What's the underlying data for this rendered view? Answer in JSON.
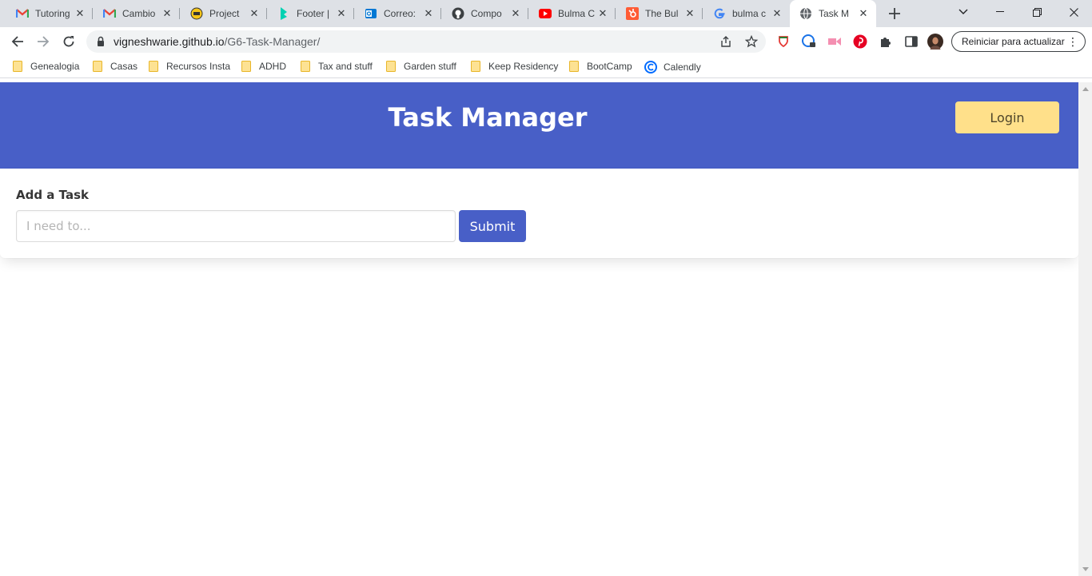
{
  "browser": {
    "tabs": [
      {
        "title": "Tutoring",
        "icon": "gmail-icon"
      },
      {
        "title": "Cambio",
        "icon": "gmail-icon"
      },
      {
        "title": "Project",
        "icon": "project-icon"
      },
      {
        "title": "Footer |",
        "icon": "bulma-icon"
      },
      {
        "title": "Correo:",
        "icon": "outlook-icon"
      },
      {
        "title": "Compo",
        "icon": "github-icon"
      },
      {
        "title": "Bulma C",
        "icon": "youtube-icon"
      },
      {
        "title": "The Bul",
        "icon": "hubspot-icon"
      },
      {
        "title": "bulma c",
        "icon": "google-icon"
      },
      {
        "title": "Task M",
        "icon": "globe-icon",
        "active": true
      }
    ],
    "url_host": "vigneshwarie.github.io",
    "url_path": "/G6-Task-Manager/",
    "restart_label": "Reiniciar para actualizar",
    "bookmarks": [
      "Genealogia",
      "Casas",
      "Recursos Insta",
      "ADHD",
      "Tax and stuff",
      "Garden stuff",
      "Keep Residency",
      "BootCamp",
      "Calendly"
    ]
  },
  "colors": {
    "primary": "#485fc7",
    "warning": "#ffe08a",
    "tabstrip": "#dee1e6"
  },
  "page": {
    "hero_title": "Task Manager",
    "login_label": "Login",
    "form_label": "Add a Task",
    "task_input_value": "",
    "task_input_placeholder": "I need to...",
    "submit_label": "Submit"
  }
}
